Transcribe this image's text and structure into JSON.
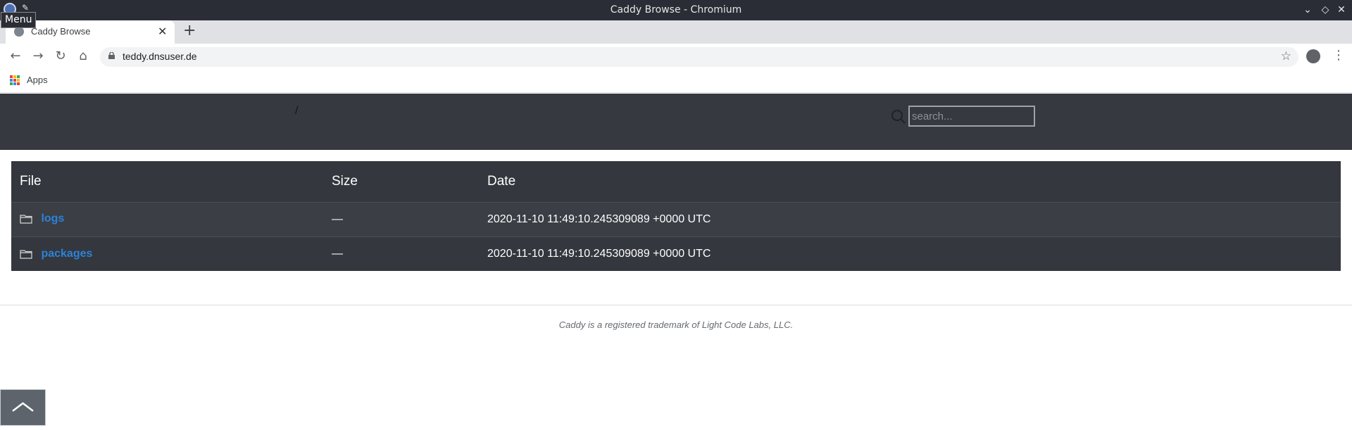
{
  "window": {
    "title": "Caddy Browse - Chromium",
    "tooltip": "Menu"
  },
  "tabs": [
    {
      "label": "Caddy Browse",
      "close": "✕"
    }
  ],
  "new_tab": "+",
  "toolbar": {
    "back": "←",
    "forward": "→",
    "reload": "↻",
    "home": "⌂",
    "url": "teddy.dnsuser.de",
    "star": "☆",
    "menu": "⋮"
  },
  "bookmarks": {
    "items": [
      {
        "label": "Apps"
      }
    ],
    "apps_colors": [
      "#ea4335",
      "#fbbc04",
      "#34a853",
      "#4285f4",
      "#ea4335",
      "#fbbc04",
      "#34a853",
      "#4285f4",
      "#ea4335"
    ]
  },
  "page": {
    "breadcrumb": "/",
    "search_placeholder": "search...",
    "columns": {
      "file": "File",
      "size": "Size",
      "date": "Date"
    },
    "rows": [
      {
        "name": "logs",
        "size": "—",
        "date": "2020-11-10 11:49:10.245309089 +0000 UTC"
      },
      {
        "name": "packages",
        "size": "—",
        "date": "2020-11-10 11:49:10.245309089 +0000 UTC"
      }
    ],
    "footer": "Caddy is a registered trademark of Light Code Labs, LLC."
  },
  "colors": {
    "header_bg": "#363940",
    "link": "#2c82d8",
    "titlebar": "#2b2d36"
  }
}
